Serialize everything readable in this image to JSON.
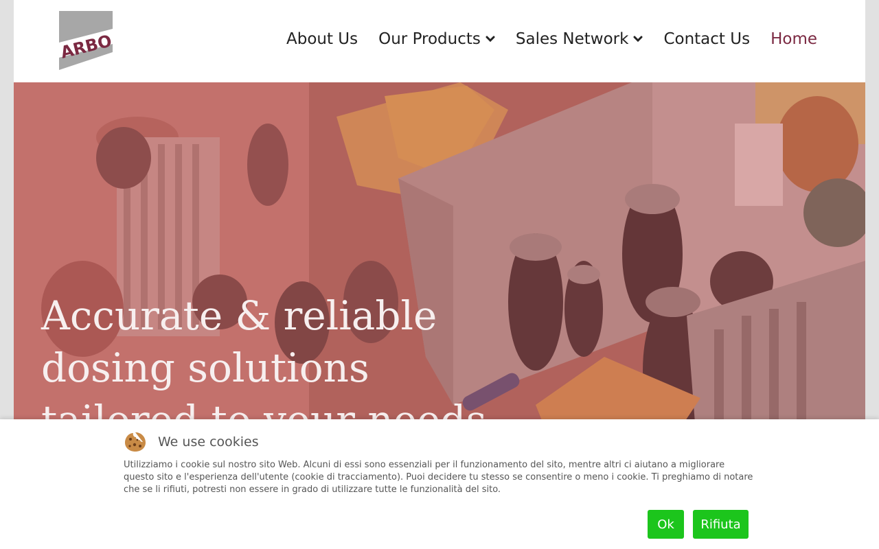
{
  "brand": {
    "logo_text": "ARBO"
  },
  "nav": {
    "items": [
      {
        "label": "About Us"
      },
      {
        "label": "Our Products"
      },
      {
        "label": "Sales Network"
      },
      {
        "label": "Contact Us"
      },
      {
        "label": "Home"
      }
    ]
  },
  "hero": {
    "line1": "Accurate & reliable",
    "line2": "dosing solutions",
    "line3": "tailored to your needs"
  },
  "cookie_banner": {
    "title": "We use cookies",
    "text": "Utilizziamo i cookie sul nostro sito Web. Alcuni di essi sono essenziali per il funzionamento del sito, mentre altri ci aiutano a migliorare questo sito e l'esperienza dell'utente (cookie di tracciamento). Puoi decidere tu stesso se consentire o meno i cookie. Ti preghiamo di notare che se li rifiuti, potresti non essere in grado di utilizzare tutte le funzionalità del sito.",
    "ok_label": "Ok",
    "reject_label": "Rifiuta"
  },
  "colors": {
    "brand": "#7b2942",
    "button": "#1cc51c",
    "hero_overlay": "#c0504d"
  }
}
